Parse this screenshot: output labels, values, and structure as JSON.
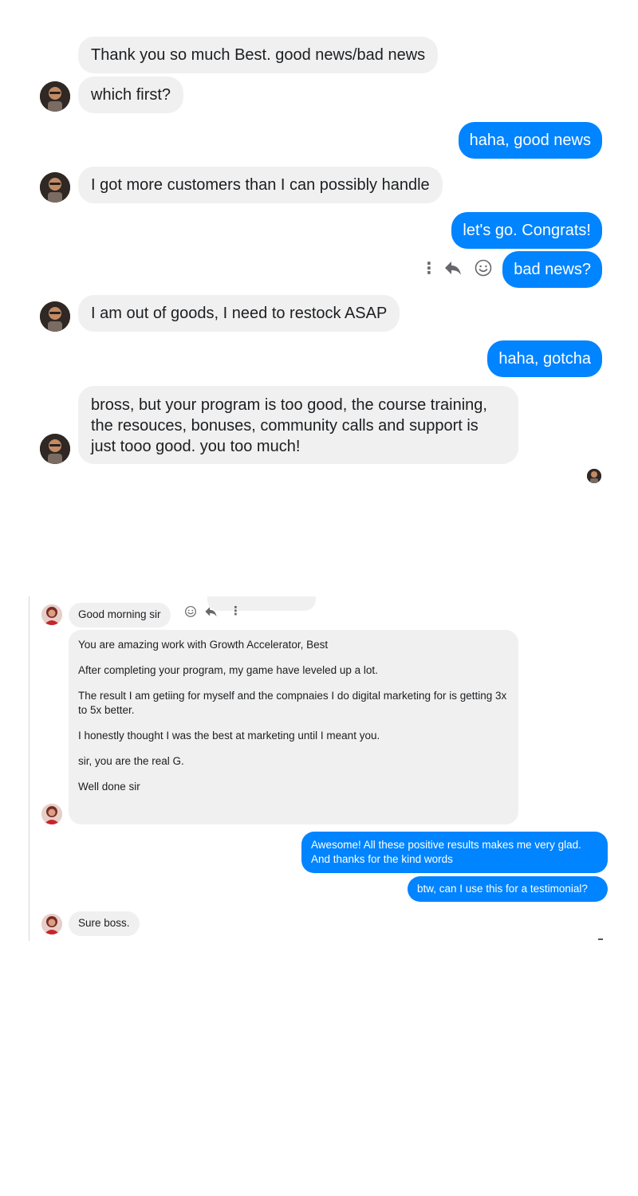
{
  "chat1": {
    "messages": [
      {
        "dir": "in",
        "text": "Thank you so much Best. good news/bad news"
      },
      {
        "dir": "in",
        "text": "which first?"
      },
      {
        "dir": "out",
        "text": "haha, good news"
      },
      {
        "dir": "in",
        "text": "I got more customers than I can possibly handle"
      },
      {
        "dir": "out",
        "text": "let's go. Congrats!"
      },
      {
        "dir": "out",
        "text": "bad news?"
      },
      {
        "dir": "in",
        "text": "I am out of goods, I need to restock ASAP"
      },
      {
        "dir": "out",
        "text": "haha, gotcha"
      },
      {
        "dir": "in",
        "text": "bross, but your program is too good, the course training, the resouces, bonuses, community calls and support is just tooo good. you too much!"
      }
    ],
    "hover_actions": {
      "more": "⋮",
      "reply": "reply-icon",
      "react": "smiley-icon"
    }
  },
  "chat2": {
    "first_message": "Good morning sir",
    "long_message": [
      "You are amazing work with Growth Accelerator, Best",
      "After completing your program, my game have leveled up a lot.",
      "The result I am getiing for myself and the compnaies I do digital marketing for is getting 3x to 5x better.",
      "I honestly thought I was the best at marketing until I meant you.",
      "sir, you are the real G.",
      "Well done sir"
    ],
    "reply_1": "Awesome! All these positive results makes me very glad. And thanks for the kind  words",
    "reply_2": "btw, can I use this for a testimonial?",
    "last_message": "Sure boss."
  },
  "colors": {
    "outgoing": "#0084ff",
    "incoming": "#f0f0f0",
    "icon": "#65676b"
  }
}
